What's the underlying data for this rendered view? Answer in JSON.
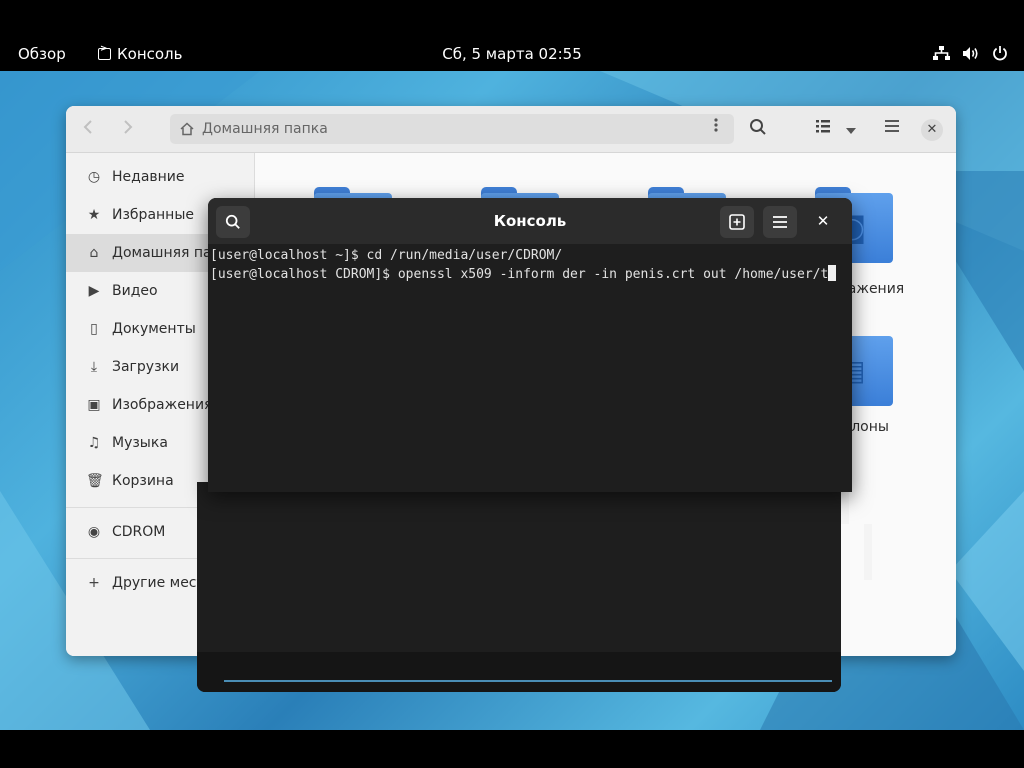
{
  "topbar": {
    "activities": "Обзор",
    "app_name": "Консоль",
    "clock": "Сб, 5 марта  02:55",
    "status_icons": [
      "network-icon",
      "volume-icon",
      "power-icon"
    ]
  },
  "files": {
    "path": "Домашняя папка",
    "sidebar": [
      {
        "label": "Недавние",
        "icon": "clock-icon"
      },
      {
        "label": "Избранные",
        "icon": "star-icon"
      },
      {
        "label": "Домашняя папка",
        "icon": "home-icon"
      },
      {
        "label": "Видео",
        "icon": "video-icon"
      },
      {
        "label": "Документы",
        "icon": "document-icon"
      },
      {
        "label": "Загрузки",
        "icon": "download-icon"
      },
      {
        "label": "Изображения",
        "icon": "image-icon"
      },
      {
        "label": "Музыка",
        "icon": "music-icon"
      },
      {
        "label": "Корзина",
        "icon": "trash-icon"
      },
      {
        "label": "CDROM",
        "icon": "disc-icon"
      },
      {
        "label": "Другие места",
        "icon": "plus-icon"
      }
    ],
    "folders": {
      "row1_last_label": "Изображения",
      "row2_last_label": "Шаблоны"
    }
  },
  "terminal": {
    "title": "Консоль",
    "lines": [
      "[user@localhost ~]$ cd /run/media/user/CDROM/",
      "[user@localhost CDROM]$ openssl x509 -inform der -in penis.crt out /home/user/t"
    ]
  },
  "colors": {
    "terminal_bg": "#1e1e1e",
    "titlebar_bg": "#2b2b2b",
    "folder_blue": "#3b7fd8",
    "accent_scroll": "#4a8db5"
  }
}
